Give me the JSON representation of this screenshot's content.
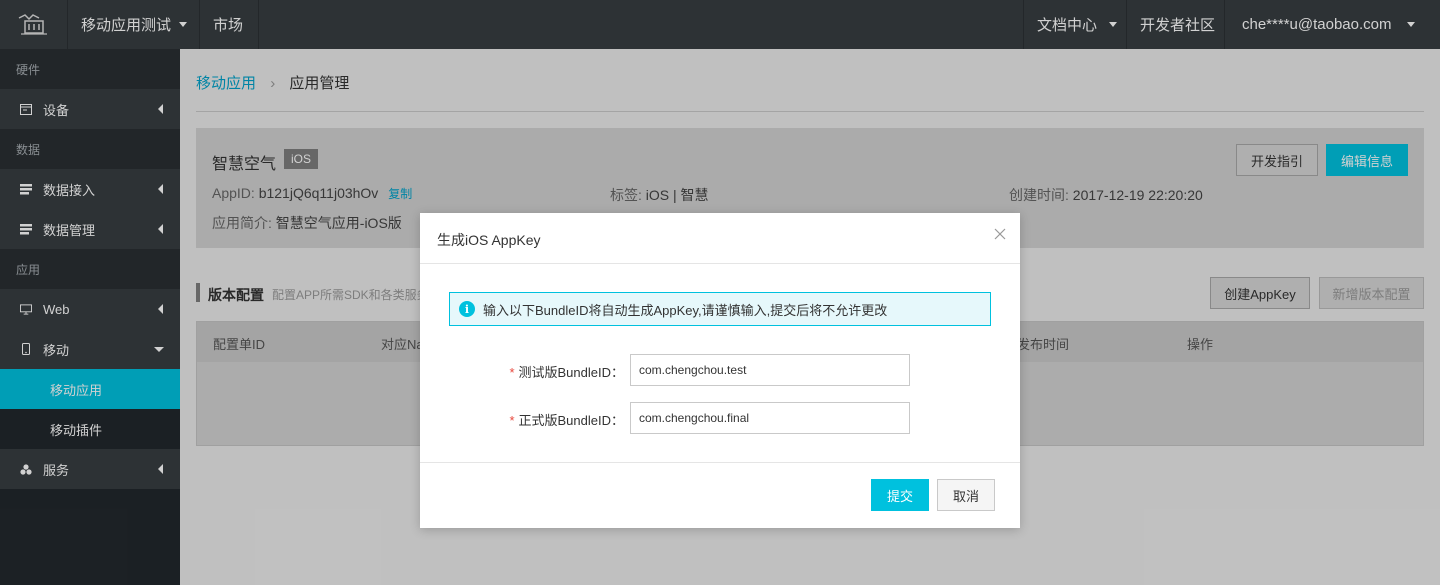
{
  "topbar": {
    "project": "移动应用测试",
    "market": "市场",
    "docs": "文档中心",
    "dev_community": "开发者社区",
    "user": "che****u@taobao.com"
  },
  "sidebar": {
    "groups": {
      "hardware": "硬件",
      "data": "数据",
      "app": "应用"
    },
    "items": {
      "device": "设备",
      "data_ingest": "数据接入",
      "data_manage": "数据管理",
      "web": "Web",
      "mobile": "移动",
      "mobile_app": "移动应用",
      "mobile_plugin": "移动插件",
      "service": "服务"
    }
  },
  "breadcrumb": {
    "parent": "移动应用",
    "current": "应用管理"
  },
  "app": {
    "name": "智慧空气",
    "platform": "iOS",
    "appid_label": "AppID:",
    "appid": "b121jQ6q11j03hOv",
    "copy": "复制",
    "tags_label": "标签:",
    "tags": "iOS | 智慧",
    "created_label": "创建时间:",
    "created": "2017-12-19 22:20:20",
    "desc_label": "应用简介:",
    "desc": "智慧空气应用-iOS版",
    "btn_guide": "开发指引",
    "btn_edit": "编辑信息"
  },
  "version": {
    "title": "版本配置",
    "desc": "配置APP所需SDK和各类服务",
    "btn_create_appkey": "创建AppKey",
    "btn_new_version": "新增版本配置",
    "columns": [
      "配置单ID",
      "对应Na",
      "发布时间",
      "操作"
    ]
  },
  "modal": {
    "title": "生成iOS AppKey",
    "alert": "输入以下BundleID将自动生成AppKey,请谨慎输入,提交后将不允许更改",
    "test_label": "测试版BundleID：",
    "test_value": "com.chengchou.test",
    "prod_label": "正式版BundleID：",
    "prod_value": "com.chengchou.final",
    "submit": "提交",
    "cancel": "取消"
  },
  "colors": {
    "accent": "#00c1de",
    "link": "#00a2ca",
    "topbar": "#373d41",
    "sidebar": "#22282d"
  }
}
